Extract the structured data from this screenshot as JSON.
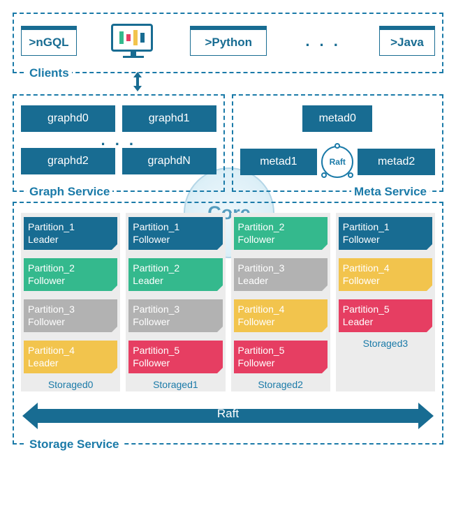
{
  "clients": {
    "label": "Clients",
    "items": [
      ">nGQL",
      ">Python",
      ">Java"
    ],
    "ellipsis": ". . ."
  },
  "graph_service": {
    "label": "Graph Service",
    "nodes": [
      "graphd0",
      "graphd1",
      "graphd2",
      "graphdN"
    ],
    "ellipsis": ". . ."
  },
  "meta_service": {
    "label": "Meta Service",
    "nodes": [
      "metad0",
      "metad1",
      "metad2"
    ],
    "raft_label": "Raft"
  },
  "core_label": "Core",
  "storage_service": {
    "label": "Storage Service",
    "raft_label": "Raft",
    "columns": [
      {
        "name": "Storaged0",
        "partitions": [
          {
            "name": "Partition_1",
            "role": "Leader",
            "color": "blue"
          },
          {
            "name": "Partition_2",
            "role": "Follower",
            "color": "green"
          },
          {
            "name": "Partition_3",
            "role": "Follower",
            "color": "grey"
          },
          {
            "name": "Partition_4",
            "role": "Leader",
            "color": "yellow"
          }
        ]
      },
      {
        "name": "Storaged1",
        "partitions": [
          {
            "name": "Partition_1",
            "role": "Follower",
            "color": "blue"
          },
          {
            "name": "Partition_2",
            "role": "Leader",
            "color": "green"
          },
          {
            "name": "Partition_3",
            "role": "Follower",
            "color": "grey"
          },
          {
            "name": "Partition_5",
            "role": "Follower",
            "color": "pink"
          }
        ]
      },
      {
        "name": "Storaged2",
        "partitions": [
          {
            "name": "Partition_2",
            "role": "Follower",
            "color": "green"
          },
          {
            "name": "Partition_3",
            "role": "Leader",
            "color": "grey"
          },
          {
            "name": "Partition_4",
            "role": "Follower",
            "color": "yellow"
          },
          {
            "name": "Partition_5",
            "role": "Follower",
            "color": "pink"
          }
        ]
      },
      {
        "name": "Storaged3",
        "partitions": [
          {
            "name": "Partition_1",
            "role": "Follower",
            "color": "blue"
          },
          {
            "name": "Partition_4",
            "role": "Follower",
            "color": "yellow"
          },
          {
            "name": "Partition_5",
            "role": "Leader",
            "color": "pink"
          }
        ]
      }
    ]
  }
}
